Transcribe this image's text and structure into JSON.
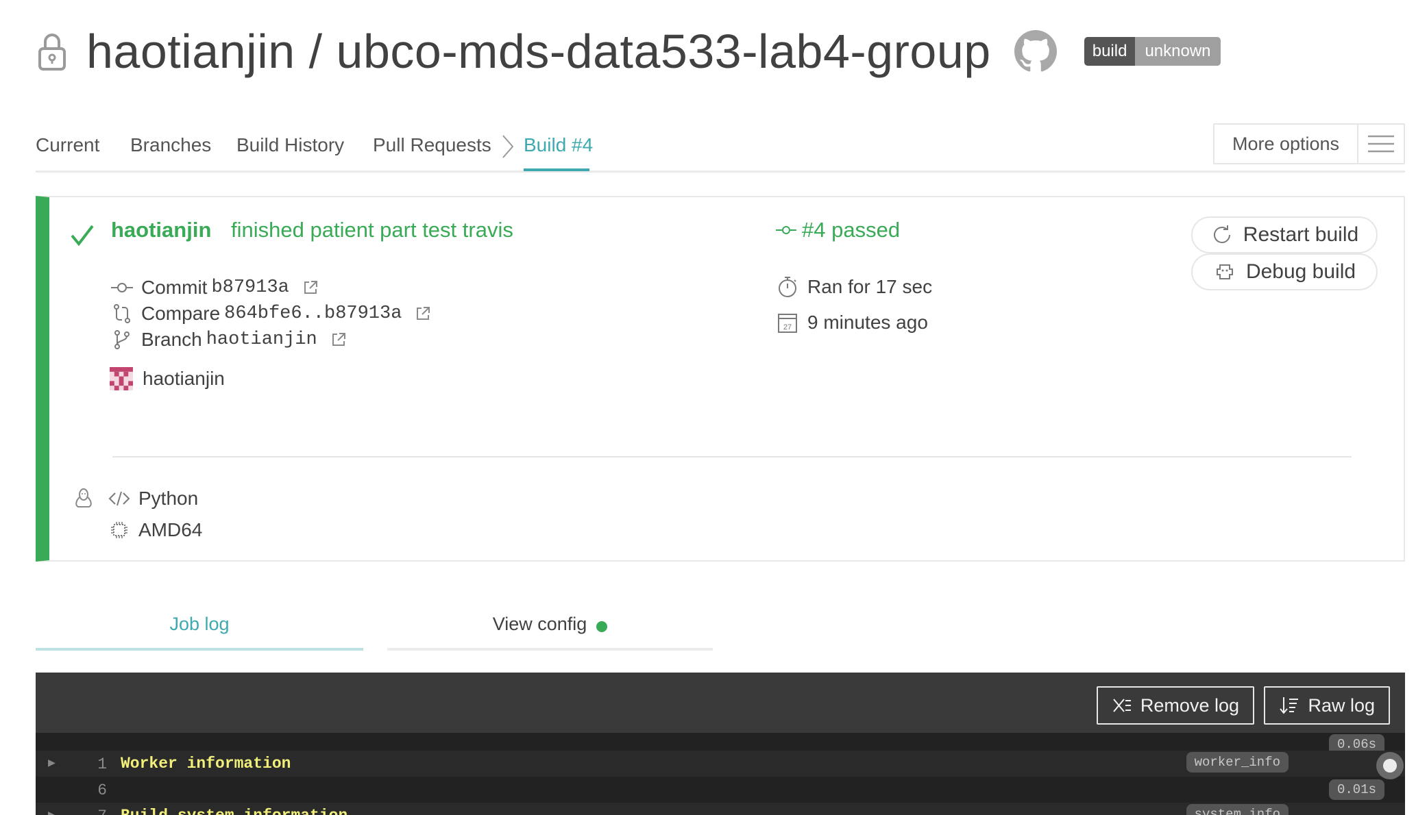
{
  "header": {
    "title": "haotianjin / ubco-mds-data533-lab4-group",
    "badge_left": "build",
    "badge_right": "unknown"
  },
  "nav": {
    "items": [
      "Current",
      "Branches",
      "Build History",
      "Pull Requests",
      "Build #4"
    ],
    "more_options": "More options"
  },
  "build": {
    "author": "haotianjin",
    "message": "finished patient part test travis",
    "commit_label": "Commit",
    "commit_sha": "b87913a",
    "compare_label": "Compare",
    "compare_range": "864bfe6..b87913a",
    "branch_label": "Branch",
    "branch_name": "haotianjin",
    "committer": "haotianjin",
    "status": "#4 passed",
    "duration": "Ran for 17 sec",
    "calendar_day": "27",
    "finished": "9 minutes ago",
    "language": "Python",
    "arch": "AMD64",
    "restart_label": "Restart build",
    "debug_label": "Debug build",
    "status_color": "#39aa56"
  },
  "job_tabs": {
    "log": "Job log",
    "config": "View config"
  },
  "log": {
    "remove_label": "Remove log",
    "raw_label": "Raw log",
    "lines": [
      {
        "num": "1",
        "text": "Worker information",
        "tag": "worker_info",
        "time": "0.06s"
      },
      {
        "num": "6",
        "text": "",
        "tag": "",
        "time": "0.01s"
      },
      {
        "num": "7",
        "text": "Build system information",
        "tag": "system_info",
        "time": ""
      }
    ]
  },
  "icons": [
    "lock-icon",
    "github-icon",
    "check-icon",
    "commit-icon",
    "compare-icon",
    "branch-icon",
    "external-link-icon",
    "stopwatch-icon",
    "calendar-icon",
    "restart-icon",
    "debug-icon",
    "linux-icon",
    "code-icon",
    "cpu-icon",
    "hamburger-icon",
    "remove-log-icon",
    "raw-log-icon"
  ]
}
